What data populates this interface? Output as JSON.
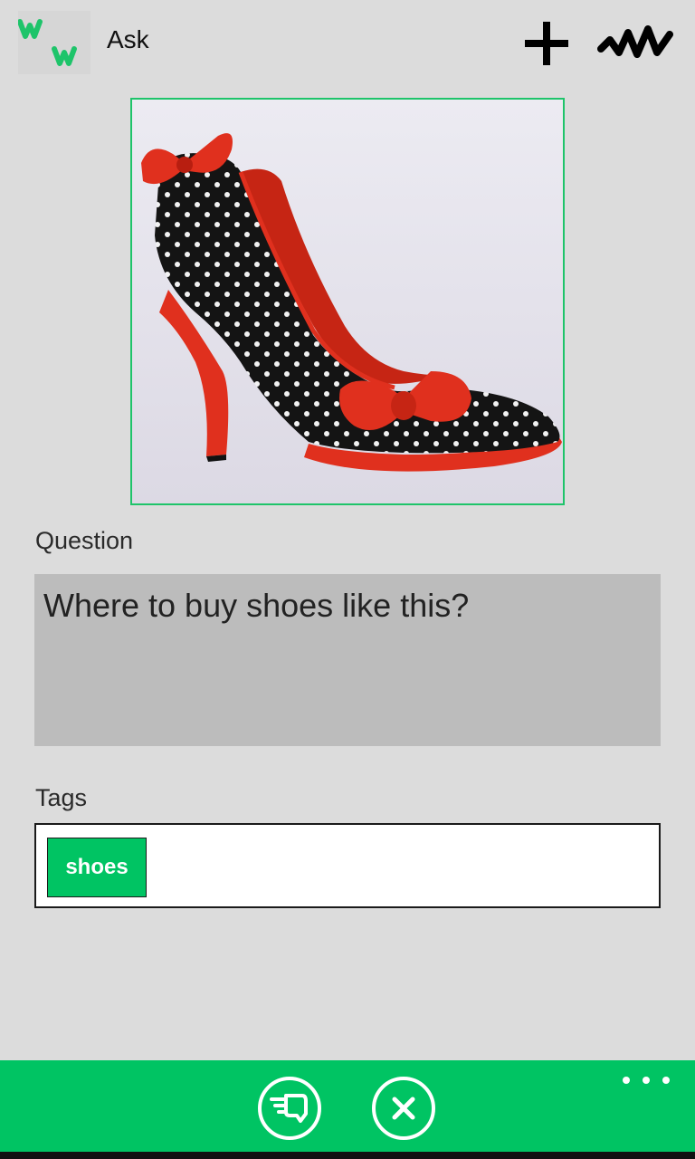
{
  "header": {
    "title": "Ask",
    "logo_text": "WW",
    "add_icon": "plus-icon",
    "activity_icon": "squiggle-icon"
  },
  "photo": {
    "subject": "red and black polka dot high heel shoe with bows"
  },
  "question": {
    "label": "Question",
    "value": "Where to buy shoes like this?"
  },
  "tags": {
    "label": "Tags",
    "items": [
      "shoes"
    ]
  },
  "app_bar": {
    "send_icon": "send-hand-icon",
    "cancel_icon": "close-icon",
    "more_icon": "ellipsis-icon"
  },
  "colors": {
    "accent": "#00c463",
    "background": "#dcdcdc",
    "question_box": "#bcbcbc"
  }
}
